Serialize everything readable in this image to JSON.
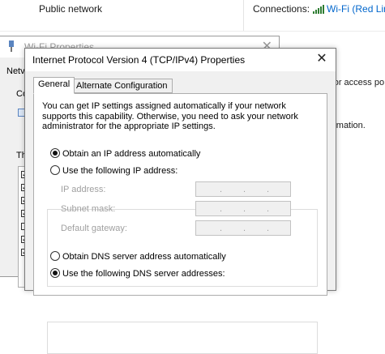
{
  "background": {
    "network_type": "Public network",
    "connections_label": "Connections:",
    "connection_link": "Wi-Fi (Red Line",
    "right_text_1": "r or access po",
    "right_text_2": "ormation."
  },
  "wifi_properties": {
    "title": "Wi-Fi Properties",
    "tab_fragment": "Netv",
    "connect_fragment": "Co",
    "items_fragment": "Th"
  },
  "dialog": {
    "title": "Internet Protocol Version 4 (TCP/IPv4) Properties",
    "close_glyph": "✕",
    "tabs": [
      {
        "label": "General",
        "active": true
      },
      {
        "label": "Alternate Configuration",
        "active": false
      }
    ],
    "intro_text": "You can get IP settings assigned automatically if your network supports this capability. Otherwise, you need to ask your network administrator for the appropriate IP settings.",
    "ip_options": {
      "auto_label": "Obtain an IP address automatically",
      "manual_label": "Use the following IP address:",
      "selected": "auto"
    },
    "ip_fields": [
      {
        "label": "IP address:",
        "value": ""
      },
      {
        "label": "Subnet mask:",
        "value": ""
      },
      {
        "label": "Default gateway:",
        "value": ""
      }
    ],
    "dns_options": {
      "auto_label": "Obtain DNS server address automatically",
      "manual_label": "Use the following DNS server addresses:",
      "selected": "manual"
    }
  },
  "colors": {
    "link": "#0066cc",
    "disabled_text": "#a0a0a0",
    "dialog_bg": "#f0f0f0"
  }
}
